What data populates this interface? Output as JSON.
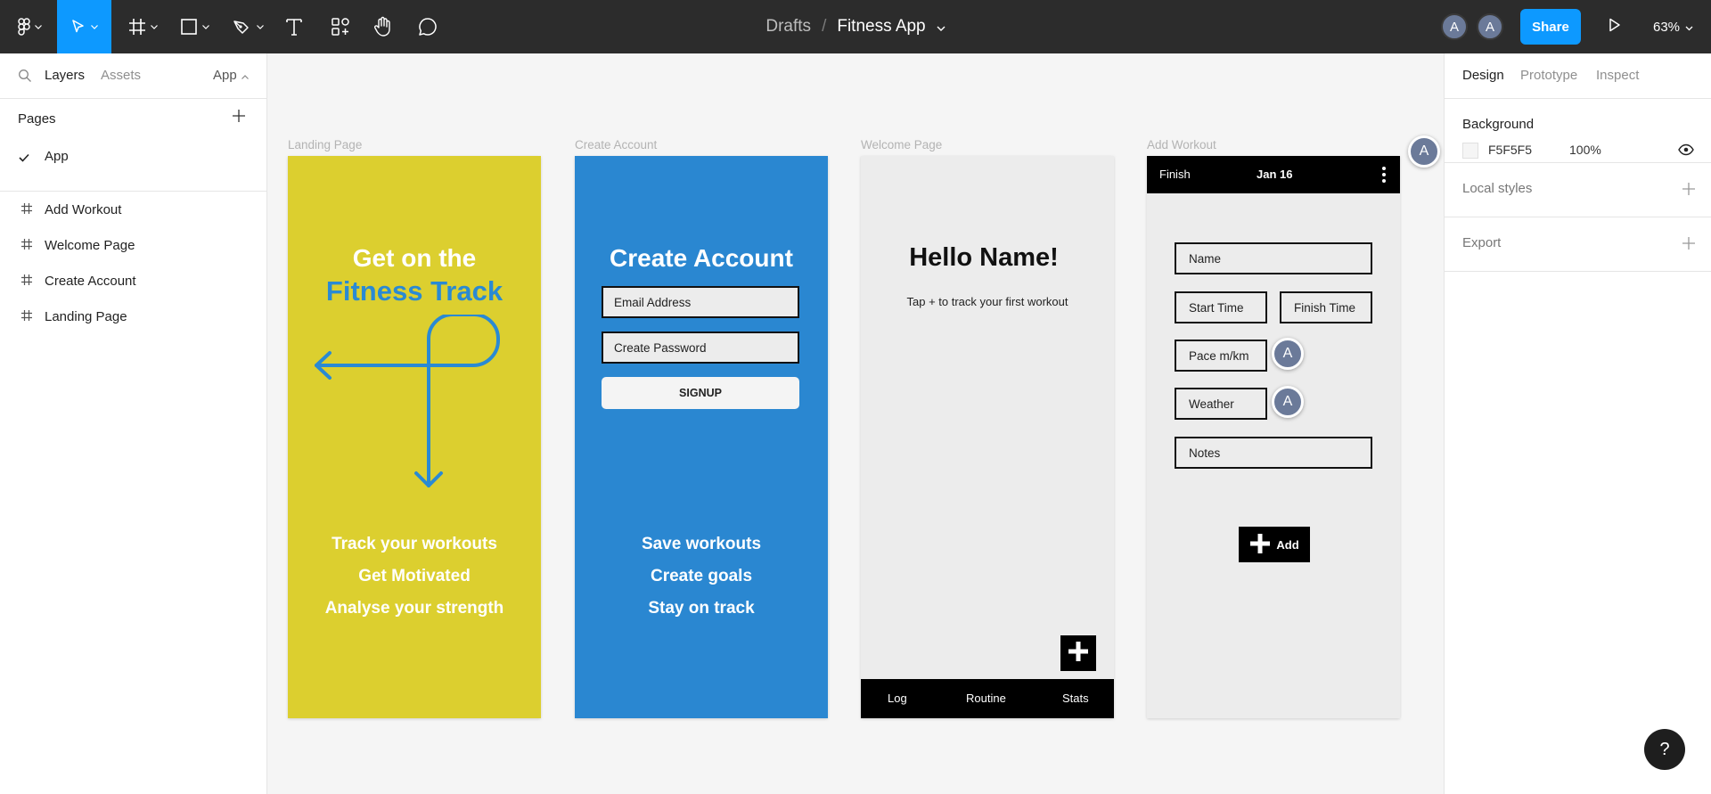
{
  "toolbar": {
    "breadcrumb_drafts": "Drafts",
    "breadcrumb_sep": "/",
    "file_name": "Fitness App",
    "avatars": [
      "A",
      "A"
    ],
    "share_label": "Share",
    "zoom": "63%"
  },
  "left_panel": {
    "tabs": {
      "layers": "Layers",
      "assets": "Assets",
      "page_switch": "App"
    },
    "pages_title": "Pages",
    "pages": [
      {
        "label": "App",
        "selected": true
      }
    ],
    "layers": [
      {
        "label": "Add Workout"
      },
      {
        "label": "Welcome Page"
      },
      {
        "label": "Create Account"
      },
      {
        "label": "Landing Page"
      }
    ]
  },
  "right_panel": {
    "tabs": {
      "design": "Design",
      "prototype": "Prototype",
      "inspect": "Inspect"
    },
    "background_title": "Background",
    "bg_hex": "F5F5F5",
    "bg_opacity": "100%",
    "local_styles": "Local styles",
    "export": "Export"
  },
  "frames": {
    "landing": {
      "label": "Landing Page",
      "title_line1": "Get on the",
      "title_line2": "Fitness Track",
      "lines": [
        "Track your workouts",
        "Get Motivated",
        "Analyse your strength"
      ],
      "bg_color": "#dccf2f"
    },
    "create": {
      "label": "Create Account",
      "title": "Create Account",
      "email": "Email Address",
      "password": "Create Password",
      "signup": "SIGNUP",
      "lines": [
        "Save workouts",
        "Create goals",
        "Stay on track"
      ],
      "bg_color": "#2a87d1"
    },
    "welcome": {
      "label": "Welcome Page",
      "hello": "Hello Name!",
      "tap": "Tap + to track your first workout",
      "nav": [
        "Log",
        "Routine",
        "Stats"
      ]
    },
    "add_workout": {
      "label": "Add Workout",
      "finish": "Finish",
      "date": "Jan 16",
      "fields": {
        "name": "Name",
        "start": "Start Time",
        "finish_time": "Finish Time",
        "pace": "Pace m/km",
        "weather": "Weather",
        "notes": "Notes"
      },
      "add": "Add"
    }
  },
  "collaborator_cursor": "A",
  "help": "?",
  "colors": {
    "accent": "#0d99ff",
    "toolbar": "#2c2c2c"
  }
}
